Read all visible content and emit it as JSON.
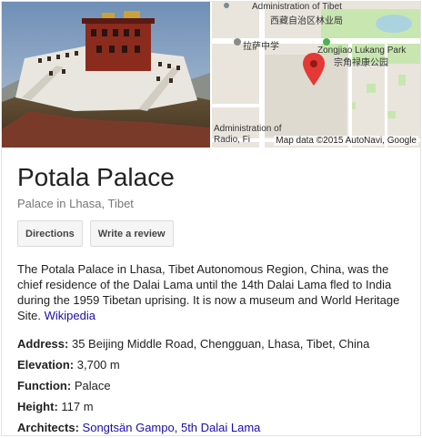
{
  "place": {
    "title": "Potala Palace",
    "subtitle": "Palace in Lhasa, Tibet"
  },
  "map": {
    "labels": {
      "admin_top_en": "Administration of Tibet",
      "admin_top_zh": "西藏自治区林业局",
      "school_zh": "拉萨中学",
      "park_en": "Zongjiao Lukang Park",
      "park_zh": "宗角禄康公园",
      "admin_bottom_en": "Administration of",
      "admin_bottom_en2": "Radio, Fi"
    },
    "credit": "Map data ©2015 AutoNavi, Google",
    "colors": {
      "road": "#ffffff",
      "block": "#e9e5dc",
      "park": "#c8e6b0",
      "water": "#aad3df",
      "pin": "#e53935"
    }
  },
  "actions": {
    "directions": "Directions",
    "review": "Write a review"
  },
  "description": {
    "text": "The Potala Palace in Lhasa, Tibet Autonomous Region, China, was the chief residence of the Dalai Lama until the 14th Dalai Lama fled to India during the 1959 Tibetan uprising. It is now a museum and World Heritage Site.",
    "link": "Wikipedia"
  },
  "facts": {
    "address": {
      "label": "Address:",
      "value": "35 Beijing Middle Road, Chengguan, Lhasa, Tibet, China"
    },
    "elevation": {
      "label": "Elevation:",
      "value": "3,700 m"
    },
    "function": {
      "label": "Function:",
      "value": "Palace"
    },
    "height": {
      "label": "Height:",
      "value": "117 m"
    },
    "architects": {
      "label": "Architects:",
      "link1": "Songtsän Gampo",
      "separator": ", ",
      "link2": "5th Dalai Lama"
    }
  }
}
